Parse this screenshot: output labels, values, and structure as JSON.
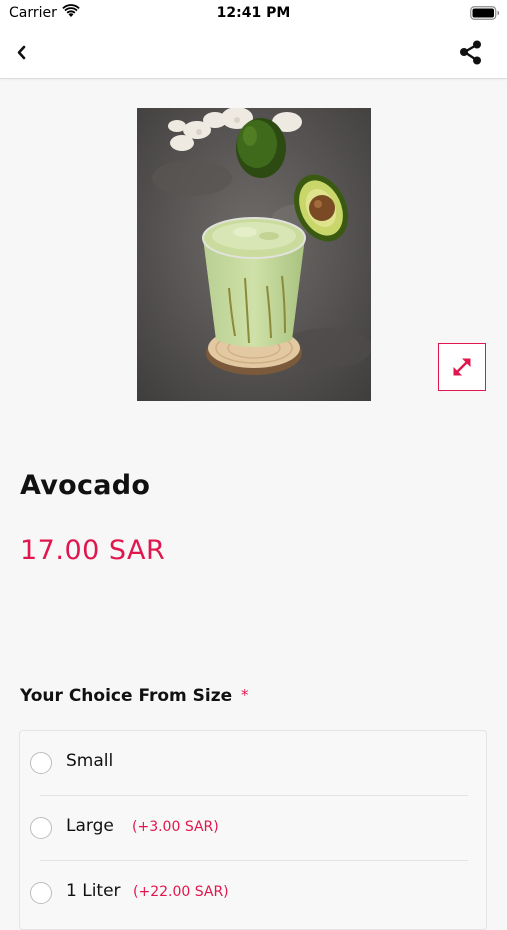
{
  "status_bar": {
    "carrier": "Carrier",
    "time": "12:41 PM",
    "wifi_icon": "wifi-icon",
    "battery_icon": "battery-icon"
  },
  "nav": {
    "back_icon": "chevron-left-icon",
    "share_icon": "share-icon"
  },
  "product": {
    "image_icon": "product-photo",
    "expand_icon": "expand-arrows-icon",
    "name": "Avocado",
    "price": "17.00 SAR"
  },
  "choice": {
    "title": "Your Choice From Size",
    "required_mark": "*",
    "options": [
      {
        "label": "Small",
        "extra": ""
      },
      {
        "label": "Large",
        "extra": "(+3.00 SAR)"
      },
      {
        "label": "1 Liter",
        "extra": "(+22.00 SAR)"
      }
    ]
  },
  "colors": {
    "accent": "#e0174e",
    "background": "#f7f7f7",
    "text": "#111111"
  }
}
